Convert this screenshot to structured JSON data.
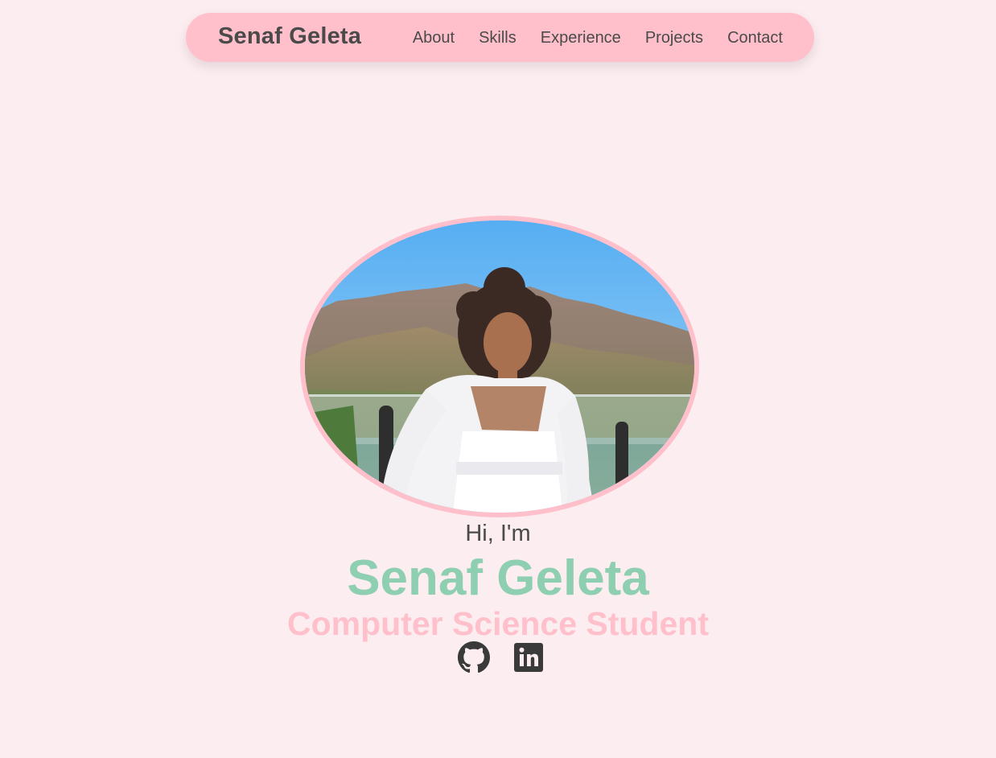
{
  "nav": {
    "brand": "Senaf Geleta",
    "links": [
      {
        "label": "About"
      },
      {
        "label": "Skills"
      },
      {
        "label": "Experience"
      },
      {
        "label": "Projects"
      },
      {
        "label": "Contact"
      }
    ]
  },
  "hero": {
    "greeting": "Hi, I'm",
    "name": "Senaf Geleta",
    "role": "Computer Science Student",
    "photo_alt": "Senaf Geleta profile photo"
  },
  "socials": [
    {
      "icon": "github-icon",
      "label": "GitHub"
    },
    {
      "icon": "linkedin-icon",
      "label": "LinkedIn"
    }
  ],
  "colors": {
    "background": "#fcedf0",
    "nav_pink": "#ffc0cb",
    "name_green": "#8ecfb2",
    "role_pink": "#ffc0cb",
    "text_dark": "#4a4a4a"
  }
}
